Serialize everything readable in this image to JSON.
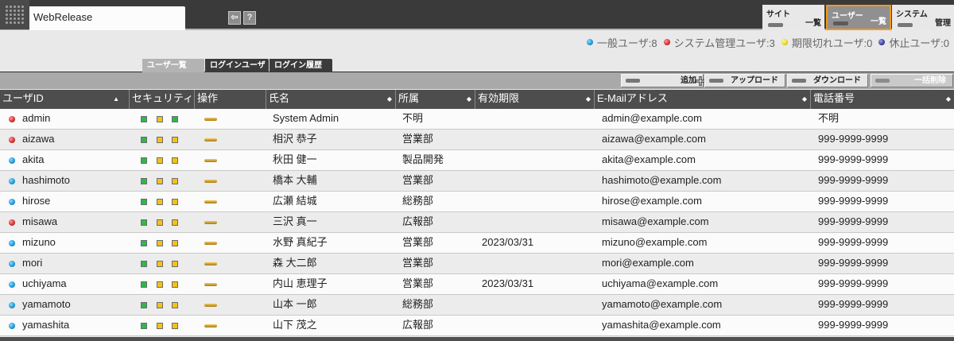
{
  "app": {
    "title": "WebRelease"
  },
  "toolbar_icons": [
    {
      "name": "back-arrow-icon",
      "glyph": "⇦"
    },
    {
      "name": "help-icon",
      "glyph": "?"
    }
  ],
  "nav": [
    {
      "label": "サイト",
      "sub": "一覧",
      "active": false
    },
    {
      "label": "ユーザー",
      "sub": "一覧",
      "active": true
    },
    {
      "label": "システム",
      "sub": "管理",
      "active": false
    }
  ],
  "legend": [
    {
      "label": "一般ユーザ:8",
      "color": "#1a97d6"
    },
    {
      "label": "システム管理ユーザ:3",
      "color": "#d12d2d"
    },
    {
      "label": "期限切れユーザ:0",
      "color": "#e6d91a"
    },
    {
      "label": "休止ユーザ:0",
      "color": "#3a3d92"
    }
  ],
  "tabs": [
    {
      "label": "ユーザ一覧",
      "active": true
    },
    {
      "label": "ログインユーザ",
      "active": false
    },
    {
      "label": "ログイン履歴",
      "active": false
    }
  ],
  "buttons": [
    {
      "label": "追加",
      "enabled": true
    },
    {
      "label": "アップロード",
      "enabled": true
    },
    {
      "label": "ダウンロード",
      "enabled": true
    },
    {
      "label": "一括削除",
      "enabled": false
    }
  ],
  "columns": [
    {
      "label": "ユーザID",
      "sort": "▲"
    },
    {
      "label": "セキュリティ",
      "sort": ""
    },
    {
      "label": "操作",
      "sort": ""
    },
    {
      "label": "氏名",
      "sort": "◆"
    },
    {
      "label": "所属",
      "sort": "◆"
    },
    {
      "label": "有効期限",
      "sort": "◆"
    },
    {
      "label": "E-Mailアドレス",
      "sort": "◆"
    },
    {
      "label": "電話番号",
      "sort": "◆"
    }
  ],
  "colors": {
    "general": "#1a97d6",
    "admin": "#d12d2d",
    "sec_green": "#2db84b",
    "sec_yellow": "#f2c21b",
    "accent_orange": "#f39a1e"
  },
  "users": [
    {
      "id": "admin",
      "type": "admin",
      "security": [
        "green",
        "yellow",
        "green"
      ],
      "name": "System Admin",
      "dept": "不明",
      "expiry": "",
      "email": "admin@example.com",
      "phone": "不明"
    },
    {
      "id": "aizawa",
      "type": "admin",
      "security": [
        "green",
        "yellow",
        "yellow"
      ],
      "name": "相沢 恭子",
      "dept": "営業部",
      "expiry": "",
      "email": "aizawa@example.com",
      "phone": "999-9999-9999"
    },
    {
      "id": "akita",
      "type": "general",
      "security": [
        "green",
        "yellow",
        "yellow"
      ],
      "name": "秋田 健一",
      "dept": "製品開発",
      "expiry": "",
      "email": "akita@example.com",
      "phone": "999-9999-9999"
    },
    {
      "id": "hashimoto",
      "type": "general",
      "security": [
        "green",
        "yellow",
        "yellow"
      ],
      "name": "橋本 大輔",
      "dept": "営業部",
      "expiry": "",
      "email": "hashimoto@example.com",
      "phone": "999-9999-9999"
    },
    {
      "id": "hirose",
      "type": "general",
      "security": [
        "green",
        "yellow",
        "yellow"
      ],
      "name": "広瀬 結城",
      "dept": "総務部",
      "expiry": "",
      "email": "hirose@example.com",
      "phone": "999-9999-9999"
    },
    {
      "id": "misawa",
      "type": "admin",
      "security": [
        "green",
        "yellow",
        "yellow"
      ],
      "name": "三沢 真一",
      "dept": "広報部",
      "expiry": "",
      "email": "misawa@example.com",
      "phone": "999-9999-9999"
    },
    {
      "id": "mizuno",
      "type": "general",
      "security": [
        "green",
        "yellow",
        "yellow"
      ],
      "name": "水野 真紀子",
      "dept": "営業部",
      "expiry": "2023/03/31",
      "email": "mizuno@example.com",
      "phone": "999-9999-9999"
    },
    {
      "id": "mori",
      "type": "general",
      "security": [
        "green",
        "yellow",
        "yellow"
      ],
      "name": "森 大二郎",
      "dept": "営業部",
      "expiry": "",
      "email": "mori@example.com",
      "phone": "999-9999-9999"
    },
    {
      "id": "uchiyama",
      "type": "general",
      "security": [
        "green",
        "yellow",
        "yellow"
      ],
      "name": "内山 恵理子",
      "dept": "営業部",
      "expiry": "2023/03/31",
      "email": "uchiyama@example.com",
      "phone": "999-9999-9999"
    },
    {
      "id": "yamamoto",
      "type": "general",
      "security": [
        "green",
        "yellow",
        "yellow"
      ],
      "name": "山本 一郎",
      "dept": "総務部",
      "expiry": "",
      "email": "yamamoto@example.com",
      "phone": "999-9999-9999"
    },
    {
      "id": "yamashita",
      "type": "general",
      "security": [
        "green",
        "yellow",
        "yellow"
      ],
      "name": "山下 茂之",
      "dept": "広報部",
      "expiry": "",
      "email": "yamashita@example.com",
      "phone": "999-9999-9999"
    }
  ]
}
